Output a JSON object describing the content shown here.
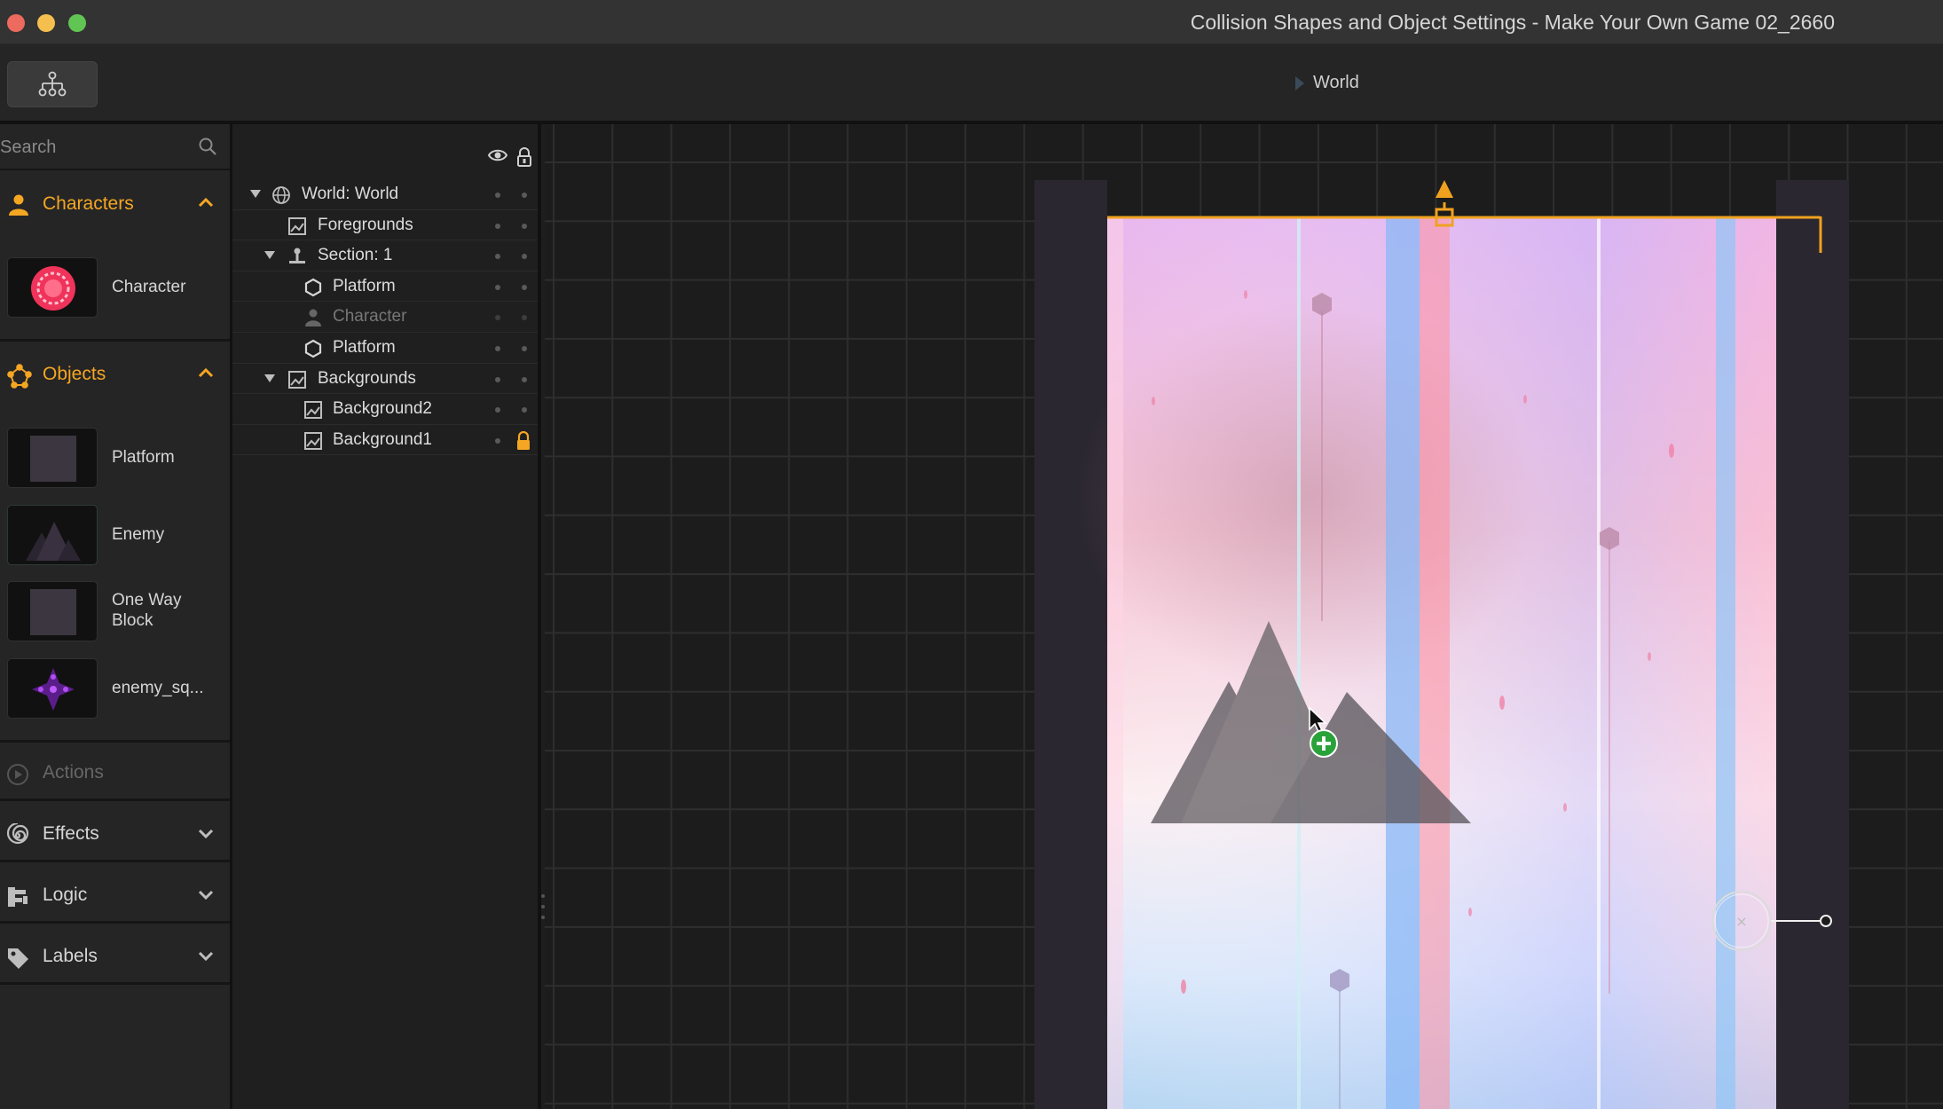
{
  "window": {
    "title": "Collision Shapes and Object Settings - Make Your Own Game 02_2660"
  },
  "toolbar": {
    "hierarchy_icon": "hierarchy-icon",
    "breadcrumb_label": "World"
  },
  "search": {
    "placeholder": "Search",
    "value": ""
  },
  "characters_section": {
    "label": "Characters",
    "items": [
      {
        "name": "Character"
      }
    ]
  },
  "objects_section": {
    "label": "Objects",
    "items": [
      {
        "name": "Platform"
      },
      {
        "name": "Enemy"
      },
      {
        "name": "One Way\nBlock"
      },
      {
        "name": "enemy_sq..."
      }
    ]
  },
  "collapsed_sections": [
    {
      "label": "Actions",
      "enabled": false
    },
    {
      "label": "Effects",
      "enabled": true
    },
    {
      "label": "Logic",
      "enabled": true
    },
    {
      "label": "Labels",
      "enabled": true
    }
  ],
  "hierarchy": {
    "rows": [
      {
        "label": "World: World",
        "icon": "globe-icon",
        "expanded": true
      },
      {
        "label": "Foregrounds",
        "icon": "image-icon"
      },
      {
        "label": "Section: 1",
        "icon": "anchor-icon",
        "expanded": true
      },
      {
        "label": "Platform",
        "icon": "hexagon-icon"
      },
      {
        "label": "Character",
        "icon": "person-icon",
        "dimmed": true
      },
      {
        "label": "Platform",
        "icon": "hexagon-icon"
      },
      {
        "label": "Backgrounds",
        "icon": "image-icon",
        "expanded": true
      },
      {
        "label": "Background2",
        "icon": "image-icon"
      },
      {
        "label": "Background1",
        "icon": "image-icon",
        "locked": true
      }
    ]
  },
  "colors": {
    "accent": "#f5a623",
    "panel": "#252525",
    "canvas": "#1c1c1c",
    "add_badge": "#2aa23a"
  }
}
